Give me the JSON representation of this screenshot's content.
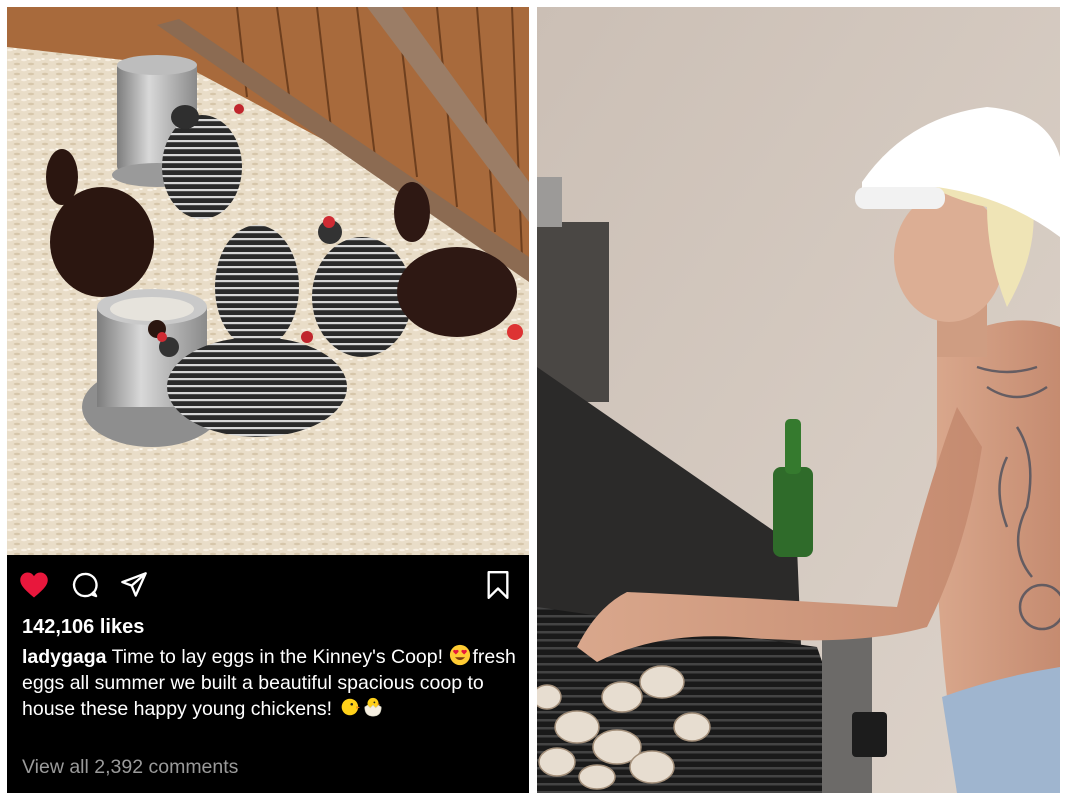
{
  "post": {
    "likes": "142,106 likes",
    "username": "ladygaga",
    "caption_part1": " Time to lay eggs in the Kinney's Coop! ",
    "caption_part2": "fresh eggs all summer we built a beautiful spacious coop to house these happy young chickens! ",
    "comments_link": "View all 2,392 comments",
    "icons": [
      "heart-icon",
      "comment-icon",
      "share-icon",
      "bookmark-icon"
    ],
    "colors": {
      "like": "#e8173c",
      "background": "#000000",
      "muted_text": "#9a9a9a"
    }
  }
}
